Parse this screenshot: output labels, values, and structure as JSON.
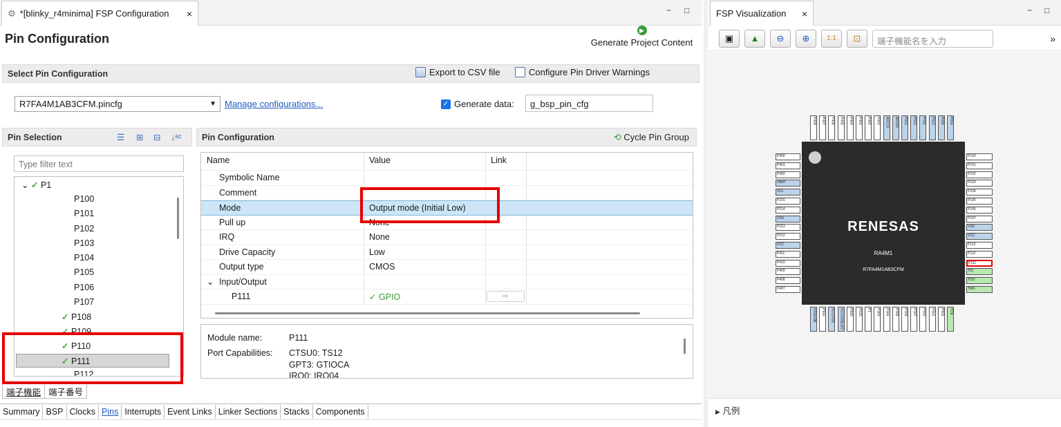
{
  "editor_tab": {
    "title": "*[blinky_r4minima] FSP Configuration",
    "close": "×"
  },
  "window_buttons": {
    "minimize": "−",
    "maximize": "□"
  },
  "page_title": "Pin Configuration",
  "generate_button": "Generate Project Content",
  "select_section": {
    "title": "Select Pin Configuration",
    "export": "Export to CSV file",
    "configure_warnings": "Configure Pin Driver Warnings"
  },
  "config_file": "R7FA4M1AB3CFM.pincfg",
  "manage_link": "Manage configurations...",
  "generate_data": {
    "label": "Generate data:",
    "value": "g_bsp_pin_cfg"
  },
  "pin_selection": {
    "title": "Pin Selection",
    "filter_placeholder": "Type filter text"
  },
  "tree": {
    "parent": "P1",
    "items": [
      {
        "label": "P100",
        "check": false
      },
      {
        "label": "P101",
        "check": false
      },
      {
        "label": "P102",
        "check": false
      },
      {
        "label": "P103",
        "check": false
      },
      {
        "label": "P104",
        "check": false
      },
      {
        "label": "P105",
        "check": false
      },
      {
        "label": "P106",
        "check": false
      },
      {
        "label": "P107",
        "check": false
      },
      {
        "label": "P108",
        "check": true
      },
      {
        "label": "P109",
        "check": true
      },
      {
        "label": "P110",
        "check": true
      },
      {
        "label": "P111",
        "check": true
      },
      {
        "label": "P112",
        "check": false
      }
    ],
    "selected": "P111"
  },
  "pin_config": {
    "title": "Pin Configuration",
    "cycle": "Cycle Pin Group",
    "columns": [
      "Name",
      "Value",
      "Link"
    ],
    "rows": [
      {
        "name": "Symbolic Name",
        "value": ""
      },
      {
        "name": "Comment",
        "value": ""
      },
      {
        "name": "Mode",
        "value": "Output mode (Initial Low)"
      },
      {
        "name": "Pull up",
        "value": "None"
      },
      {
        "name": "IRQ",
        "value": "None"
      },
      {
        "name": "Drive Capacity",
        "value": "Low"
      },
      {
        "name": "Output type",
        "value": "CMOS"
      },
      {
        "name": "Input/Output",
        "value": ""
      },
      {
        "name": "P111",
        "value": "GPIO"
      }
    ]
  },
  "module": {
    "name_label": "Module name:",
    "name": "P111",
    "cap_label": "Port Capabilities:",
    "caps": [
      "CTSU0: TS12",
      "GPT3: GTIOCA",
      "IRQ0: IRQ04"
    ]
  },
  "view_tabs": [
    "端子機能",
    "端子番号"
  ],
  "bottom_tabs": [
    "Summary",
    "BSP",
    "Clocks",
    "Pins",
    "Interrupts",
    "Event Links",
    "Linker Sections",
    "Stacks",
    "Components"
  ],
  "active_bottom_tab": "Pins",
  "viz": {
    "tab": "FSP Visualization",
    "search_placeholder": "端子機能名を入力",
    "chevron": "»",
    "legend": "凡例",
    "chip": {
      "brand": "RENESAS",
      "series": "RA4M1",
      "part": "R7FA4M1AB3CFM"
    },
    "left_pins": [
      "P400",
      "P401",
      "P402",
      "VBAT",
      "VCL",
      "P215",
      "P214",
      "VSS",
      "P213",
      "P212",
      "VCC",
      "P411",
      "P410",
      "P409",
      "P408",
      "P407"
    ],
    "right_pins": [
      "P100",
      "P101",
      "P102",
      "P103",
      "P104",
      "P105",
      "P106",
      "P107",
      "VSS",
      "VCC",
      "P113",
      "P112",
      "P111",
      "TDI",
      "TDO",
      "TMS"
    ],
    "top_pins": [
      "P408",
      "P407",
      "P406",
      "P405",
      "P404",
      "P403",
      "P402",
      "P401",
      "AVCC0",
      "AVSS0",
      "P013",
      "P012",
      "P011",
      "P010",
      "P015",
      "P014"
    ],
    "bottom_pins": [
      "VSSUSB",
      "P914",
      "VCCUSB",
      "VCCUSBLDO",
      "P915",
      "P015",
      "P1",
      "P303",
      "P304",
      "P305",
      "P306",
      "P307",
      "P500",
      "P501",
      "P502",
      "TCK"
    ],
    "colors": {
      "highlight": "#e60000",
      "green": "#b9e8b0",
      "blue": "#bcd3ea",
      "chip": "#2b2b2b"
    }
  }
}
